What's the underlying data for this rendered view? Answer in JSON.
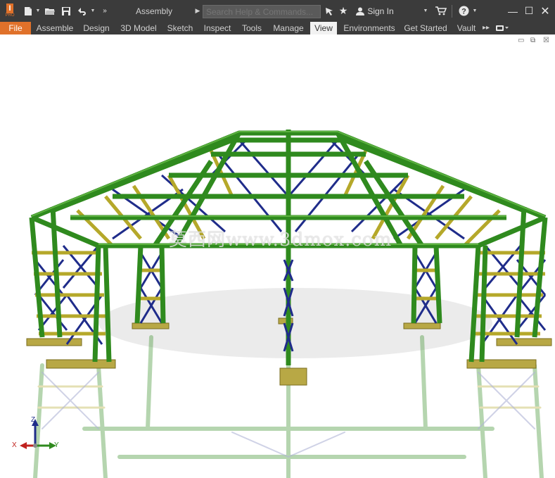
{
  "titlebar": {
    "app_logo_letter": "I",
    "app_logo_sub": "PRO",
    "title": "Assembly",
    "search_placeholder": "Search Help & Commands...",
    "sign_in": "Sign In",
    "quick_access": [
      "new-icon",
      "open-icon",
      "save-icon",
      "undo-icon",
      "more-icon"
    ]
  },
  "ribbon": {
    "tabs": [
      {
        "label": "File"
      },
      {
        "label": "Assemble"
      },
      {
        "label": "Design"
      },
      {
        "label": "3D Model"
      },
      {
        "label": "Sketch"
      },
      {
        "label": "Inspect"
      },
      {
        "label": "Tools"
      },
      {
        "label": "Manage"
      },
      {
        "label": "View"
      },
      {
        "label": "Environments"
      },
      {
        "label": "Get Started"
      },
      {
        "label": "Vault"
      }
    ],
    "active_tab": "View"
  },
  "viewport": {
    "watermark": "莫西网www.3dmox.com",
    "triad": {
      "x": "X",
      "y": "Y",
      "z": "Z"
    }
  },
  "colors": {
    "frame_green": "#2f8a1e",
    "brace_blue": "#1f2c8a",
    "purlin_yellow": "#b5a82a",
    "accent_orange": "#e0712a"
  }
}
